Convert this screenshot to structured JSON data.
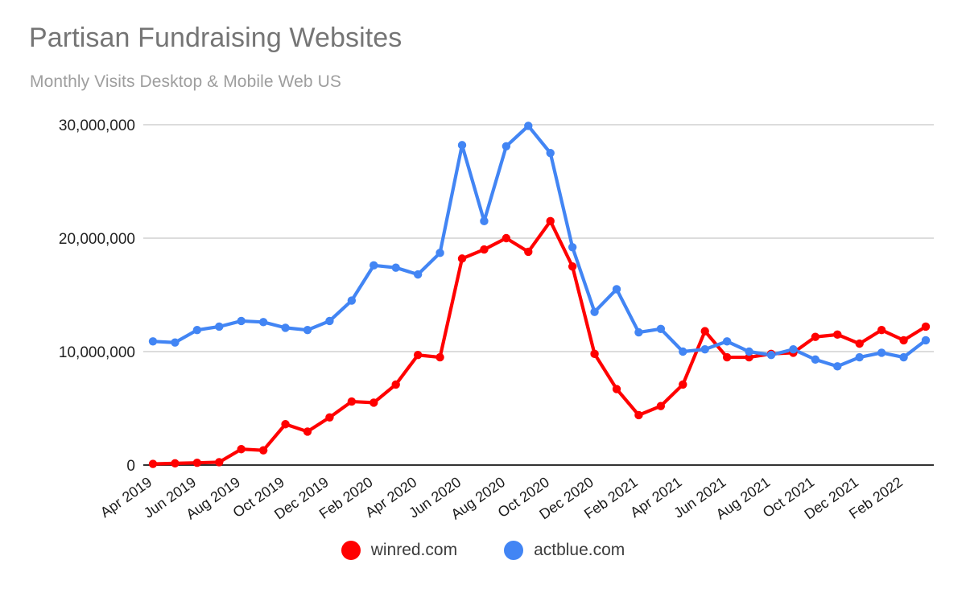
{
  "header": {
    "title": "Partisan Fundraising Websites",
    "subtitle": "Monthly Visits Desktop & Mobile Web US"
  },
  "legend": {
    "items": [
      {
        "label": "winred.com",
        "color": "#FF0000",
        "swatch_name": "legend-swatch-winred"
      },
      {
        "label": "actblue.com",
        "color": "#4285F4",
        "swatch_name": "legend-swatch-actblue"
      }
    ]
  },
  "axes": {
    "y_ticks": [
      "0",
      "10,000,000",
      "20,000,000",
      "30,000,000"
    ],
    "x_ticks": [
      "Apr 2019",
      "Jun 2019",
      "Aug 2019",
      "Oct 2019",
      "Dec 2019",
      "Feb 2020",
      "Apr 2020",
      "Jun 2020",
      "Aug 2020",
      "Oct 2020",
      "Dec 2020",
      "Feb 2021",
      "Apr 2021",
      "Jun 2021",
      "Aug 2021",
      "Oct 2021",
      "Dec 2021",
      "Feb 2022"
    ]
  },
  "chart_data": {
    "type": "line",
    "title": "Partisan Fundraising Websites",
    "subtitle": "Monthly Visits Desktop & Mobile Web US",
    "xlabel": "",
    "ylabel": "",
    "ylim": [
      0,
      30000000
    ],
    "ytick_values": [
      0,
      10000000,
      20000000,
      30000000
    ],
    "grid": "horizontal",
    "legend_position": "bottom-center",
    "markers": true,
    "x": [
      "Apr 2019",
      "May 2019",
      "Jun 2019",
      "Jul 2019",
      "Aug 2019",
      "Sep 2019",
      "Oct 2019",
      "Nov 2019",
      "Dec 2019",
      "Jan 2020",
      "Feb 2020",
      "Mar 2020",
      "Apr 2020",
      "May 2020",
      "Jun 2020",
      "Jul 2020",
      "Aug 2020",
      "Sep 2020",
      "Oct 2020",
      "Nov 2020",
      "Dec 2020",
      "Jan 2021",
      "Feb 2021",
      "Mar 2021",
      "Apr 2021",
      "May 2021",
      "Jun 2021",
      "Jul 2021",
      "Aug 2021",
      "Sep 2021",
      "Oct 2021",
      "Nov 2021",
      "Dec 2021",
      "Jan 2022",
      "Feb 2022",
      "Mar 2022"
    ],
    "series": [
      {
        "name": "winred.com",
        "color": "#FF0000",
        "values": [
          100000,
          150000,
          200000,
          250000,
          1400000,
          1300000,
          3600000,
          2950000,
          4200000,
          5600000,
          5500000,
          7100000,
          9700000,
          9500000,
          18200000,
          19000000,
          20000000,
          18800000,
          21500000,
          17500000,
          9800000,
          6700000,
          4400000,
          5200000,
          7100000,
          11800000,
          9500000,
          9500000,
          9800000,
          9900000,
          11300000,
          11500000,
          10700000,
          11900000,
          11000000,
          12200000
        ]
      },
      {
        "name": "actblue.com",
        "color": "#4285F4",
        "values": [
          10900000,
          10800000,
          11900000,
          12200000,
          12700000,
          12600000,
          12100000,
          11900000,
          12700000,
          14500000,
          17600000,
          17400000,
          16800000,
          18700000,
          28200000,
          21500000,
          28100000,
          29900000,
          27500000,
          19200000,
          13500000,
          15500000,
          11700000,
          12000000,
          10000000,
          10200000,
          10900000,
          10000000,
          9700000,
          10200000,
          9300000,
          8700000,
          9500000,
          9900000,
          9500000,
          11000000
        ]
      }
    ]
  }
}
